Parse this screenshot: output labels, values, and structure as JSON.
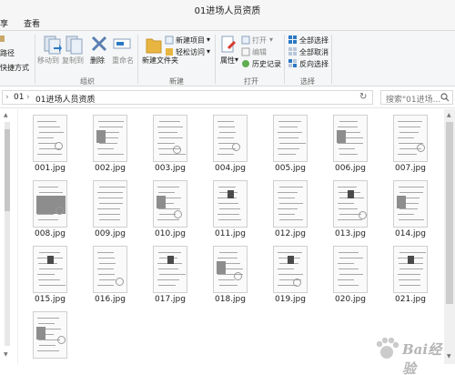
{
  "window": {
    "title": "01进场人员资质"
  },
  "tabs": [
    {
      "label": "享"
    },
    {
      "label": "查看"
    }
  ],
  "ribbon": {
    "clipboard": {
      "path_label": "路径",
      "shortcut_label": "快捷方式"
    },
    "organize": {
      "move_to": "移动到",
      "copy_to": "复制到",
      "delete": "删除",
      "rename": "重命名",
      "group_label": "组织"
    },
    "new": {
      "new_folder": "新建文件夹",
      "new_item": "新建项目",
      "easy_access": "轻松访问",
      "group_label": "新建"
    },
    "open": {
      "properties": "属性",
      "open": "打开",
      "edit": "编辑",
      "history": "历史记录",
      "group_label": "打开"
    },
    "select": {
      "select_all": "全部选择",
      "select_none": "全部取消",
      "invert": "反向选择",
      "group_label": "选择"
    }
  },
  "address": {
    "crumbs": [
      "01",
      "01进场人员资质"
    ],
    "search_placeholder": "搜索\"01进场..."
  },
  "files": [
    {
      "name": "001.jpg"
    },
    {
      "name": "002.jpg"
    },
    {
      "name": "003.jpg"
    },
    {
      "name": "004.jpg"
    },
    {
      "name": "005.jpg"
    },
    {
      "name": "006.jpg"
    },
    {
      "name": "007.jpg"
    },
    {
      "name": "008.jpg"
    },
    {
      "name": "009.jpg"
    },
    {
      "name": "010.jpg"
    },
    {
      "name": "011.jpg"
    },
    {
      "name": "012.jpg"
    },
    {
      "name": "013.jpg"
    },
    {
      "name": "014.jpg"
    },
    {
      "name": "015.jpg"
    },
    {
      "name": "016.jpg"
    },
    {
      "name": "017.jpg"
    },
    {
      "name": "018.jpg"
    },
    {
      "name": "019.jpg"
    },
    {
      "name": "020.jpg"
    },
    {
      "name": "021.jpg"
    },
    {
      "name": ""
    }
  ],
  "watermark": {
    "text": "Bai经验"
  },
  "colors": {
    "accent_blue": "#2b78c5",
    "folder_yellow": "#e8b640",
    "delete_red": "#d63b2f"
  }
}
